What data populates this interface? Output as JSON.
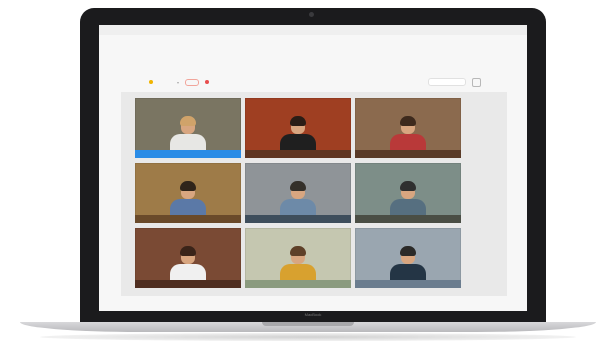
{
  "device": {
    "label": "MacBook"
  },
  "menubar": {
    "items": [
      "",
      "",
      "",
      "",
      "",
      "",
      ""
    ],
    "clock": ""
  },
  "app": {
    "brand": "",
    "nav": [
      "",
      ""
    ],
    "pill_label": "",
    "recording_label": "",
    "search_placeholder": ""
  },
  "video_grid": {
    "rows": 3,
    "cols": 3,
    "tiles": [
      {
        "name": "participant-1",
        "bg": "#7a7562",
        "shirt": "#e7e7e4",
        "hair": "#d0a36a",
        "desk": "#2b8ce6"
      },
      {
        "name": "participant-2",
        "bg": "#9f3f22",
        "shirt": "#1f1f1f",
        "hair": "#2a1d16",
        "desk": "#5f3521"
      },
      {
        "name": "participant-3",
        "bg": "#8b6a4e",
        "shirt": "#b93939",
        "hair": "#3e2a1d",
        "desk": "#5a3b28"
      },
      {
        "name": "participant-4",
        "bg": "#9e7b48",
        "shirt": "#5b79a7",
        "hair": "#2f241a",
        "desk": "#6a4a2a"
      },
      {
        "name": "participant-5",
        "bg": "#8f9498",
        "shirt": "#6d8aa8",
        "hair": "#34302a",
        "desk": "#3e4e5c"
      },
      {
        "name": "participant-6",
        "bg": "#7d8e88",
        "shirt": "#566f80",
        "hair": "#2f2f2f",
        "desk": "#4a4e45"
      },
      {
        "name": "participant-7",
        "bg": "#7a4a34",
        "shirt": "#f0f0f0",
        "hair": "#3a2419",
        "desk": "#4f2e20"
      },
      {
        "name": "participant-8",
        "bg": "#c5c7b0",
        "shirt": "#d8a12f",
        "hair": "#5e4028",
        "desk": "#8b9b7f"
      },
      {
        "name": "participant-9",
        "bg": "#9aa6b0",
        "shirt": "#243545",
        "hair": "#2b2a28",
        "desk": "#6b7d8f"
      }
    ]
  }
}
